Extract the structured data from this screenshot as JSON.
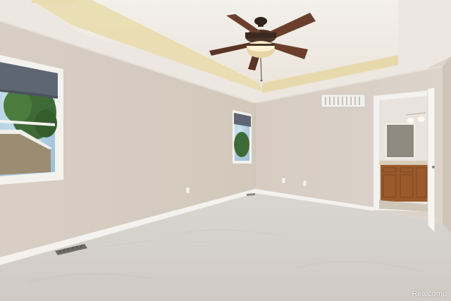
{
  "photo": {
    "subject": "empty-bedroom-interior",
    "watermark": "Realcomp"
  },
  "colors": {
    "wall": "#d9cfc4",
    "ceiling": "#efeae3",
    "tray_glow": "#e8d9a8",
    "carpet": "#d6d2cd",
    "trim": "#f4f2ee",
    "fan_blade": "#6b3f2c",
    "vanity_wood": "#9a5a2a"
  },
  "icons": {
    "ceiling_fan": "ceiling-fan-icon",
    "floor_vent": "floor-vent-icon"
  }
}
